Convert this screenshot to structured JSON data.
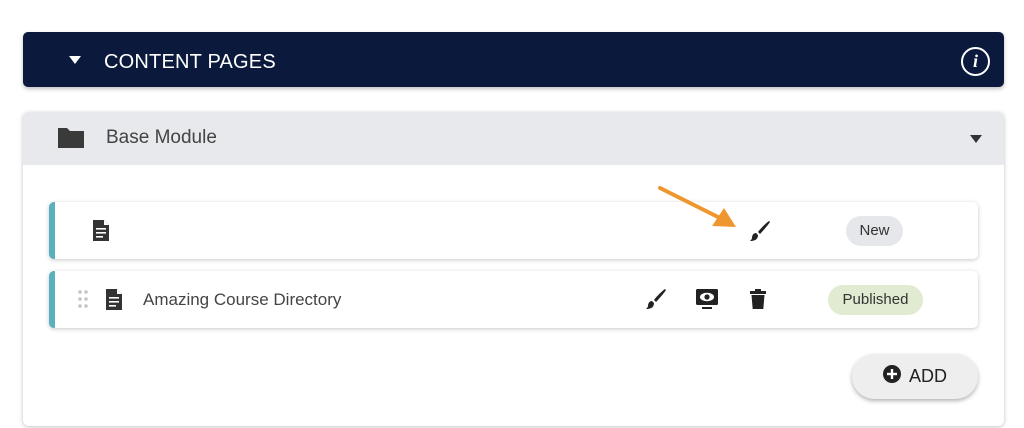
{
  "header": {
    "title": "CONTENT PAGES",
    "info_symbol": "i",
    "background": "#0b1a3c"
  },
  "module": {
    "title": "Base Module",
    "icon": "folder-icon"
  },
  "rows": [
    {
      "label": "",
      "icon": "document-icon",
      "actions": [
        "paintbrush-icon"
      ],
      "status": "New",
      "status_color": "#e6e7ea"
    },
    {
      "label": "Amazing Course Directory",
      "icon": "document-icon",
      "actions": [
        "paintbrush-icon",
        "preview-icon",
        "trash-icon"
      ],
      "status": "Published",
      "status_color": "#e1ebd2"
    }
  ],
  "add_button": {
    "label": "ADD",
    "icon": "plus-circle-icon"
  },
  "accent_color": "#5ab0be",
  "annotation": {
    "icon": "arrow-icon",
    "color": "#f0962e"
  }
}
